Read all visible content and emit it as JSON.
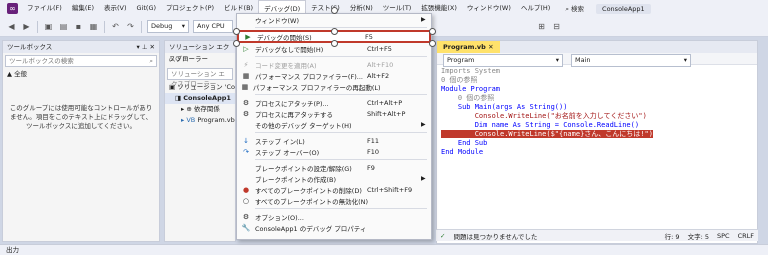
{
  "menubar": {
    "items": [
      "ファイル(F)",
      "編集(E)",
      "表示(V)",
      "Git(G)",
      "プロジェクト(P)",
      "ビルド(B)",
      "デバッグ(D)",
      "テスト(S)",
      "分析(N)",
      "ツール(T)",
      "拡張機能(X)",
      "ウィンドウ(W)",
      "ヘルプ(H)"
    ],
    "search": "検索",
    "app_name": "ConsoleApp1"
  },
  "toolbar": {
    "config": "Debug",
    "platform": "Any CPU"
  },
  "toolbox": {
    "title": "ツールボックス",
    "search_placeholder": "ツールボックスの検索",
    "group": "▲ 全般",
    "empty_message": "このグループには使用可能なコントロールがありません。項目をこのテキスト上にドラッグして、ツールボックスに追加してください。"
  },
  "solution_explorer": {
    "title": "ソリューション エクスプローラー",
    "search_placeholder": "ソリューション エクスプローラー",
    "items": [
      "ソリューション 'Consol",
      "ConsoleApp1",
      "依存関係",
      "Program.vb"
    ]
  },
  "debug_menu": {
    "items": [
      {
        "label": "ウィンドウ(W)",
        "shortcut": "",
        "submenu": true,
        "icon": "",
        "disabled": false
      },
      {
        "label": "デバッグの開始(S)",
        "shortcut": "F5",
        "icon": "▶",
        "disabled": false,
        "highlighted": true
      },
      {
        "label": "デバッグなしで開始(H)",
        "shortcut": "Ctrl+F5",
        "icon": "▷",
        "disabled": false
      },
      {
        "label": "コード変更を適用(A)",
        "shortcut": "Alt+F10",
        "icon": "⚡",
        "disabled": true
      },
      {
        "label": "パフォーマンス プロファイラー(F)...",
        "shortcut": "Alt+F2",
        "icon": "▦",
        "disabled": false
      },
      {
        "label": "パフォーマンス プロファイラーの再起動(L)",
        "shortcut": "",
        "icon": "▦",
        "disabled": false
      },
      {
        "label": "プロセスにアタッチ(P)...",
        "shortcut": "Ctrl+Alt+P",
        "icon": "⚙",
        "disabled": false
      },
      {
        "label": "プロセスに再アタッチする",
        "shortcut": "Shift+Alt+P",
        "icon": "⚙",
        "disabled": false
      },
      {
        "label": "その他のデバッグ ターゲット(H)",
        "shortcut": "",
        "submenu": true,
        "icon": "",
        "disabled": false
      },
      {
        "label": "ステップ イン(L)",
        "shortcut": "F11",
        "icon": "↓",
        "disabled": false
      },
      {
        "label": "ステップ オーバー(O)",
        "shortcut": "F10",
        "icon": "↷",
        "disabled": false
      },
      {
        "label": "ブレークポイントの設定/解除(G)",
        "shortcut": "F9",
        "icon": "",
        "disabled": false
      },
      {
        "label": "ブレークポイントの作成(B)",
        "shortcut": "",
        "submenu": true,
        "icon": "",
        "disabled": false
      },
      {
        "label": "すべてのブレークポイントの削除(D)",
        "shortcut": "Ctrl+Shift+F9",
        "icon": "●",
        "disabled": false
      },
      {
        "label": "すべてのブレークポイントの無効化(N)",
        "shortcut": "",
        "icon": "○",
        "disabled": false
      },
      {
        "label": "オプション(O)...",
        "shortcut": "",
        "icon": "⚙",
        "disabled": false
      },
      {
        "label": "ConsoleApp1 のデバッグ プロパティ",
        "shortcut": "",
        "icon": "🔧",
        "disabled": false
      }
    ]
  },
  "editor": {
    "tab": "Program.vb",
    "nav_left": "Program",
    "nav_right": "Main",
    "lines": [
      "Imports System",
      "",
      "0 個の参照",
      "Module Program",
      "    0 個の参照",
      "    Sub Main(args As String())",
      "        Console.WriteLine(\"お名前を入力してください\")",
      "        Dim name As String = Console.ReadLine()",
      "        Console.WriteLine($\"{name}さん、こんにちは!\")",
      "",
      "    End Sub",
      "End Module"
    ],
    "status_issues": "問題は見つかりませんでした",
    "status_line": "行: 9",
    "status_col": "文字: 5",
    "status_spc": "SPC",
    "status_crlf": "CRLF"
  },
  "statusbar": {
    "output": "出力"
  }
}
